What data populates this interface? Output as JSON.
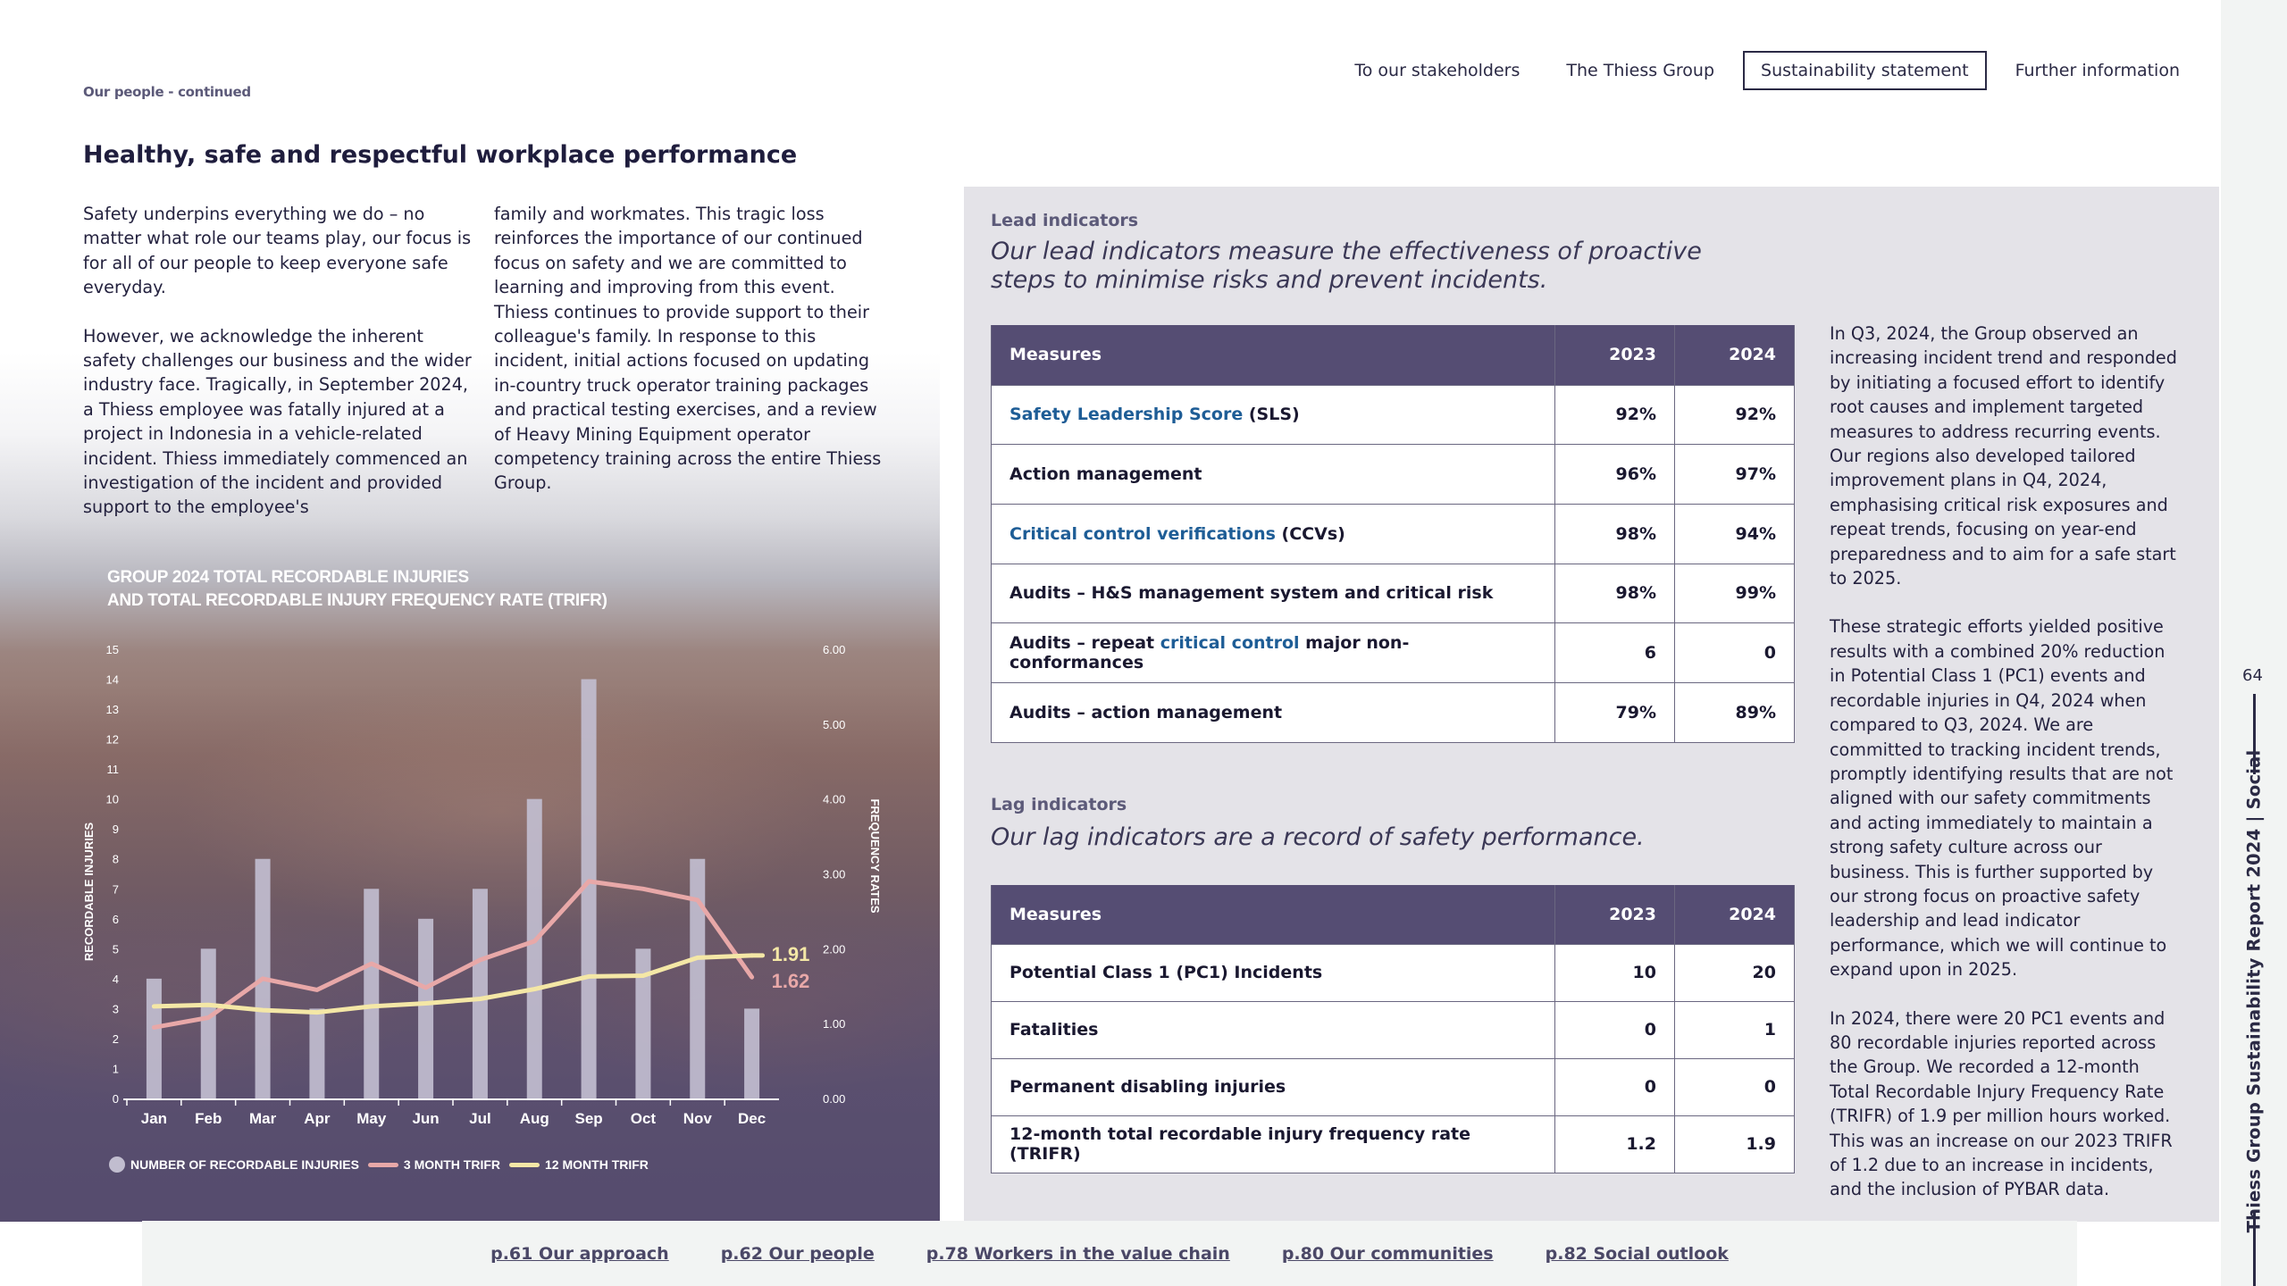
{
  "nav": {
    "items": [
      {
        "label": "To our stakeholders",
        "active": false
      },
      {
        "label": "The Thiess Group",
        "active": false
      },
      {
        "label": "Sustainability statement",
        "active": true
      },
      {
        "label": "Further information",
        "active": false
      }
    ]
  },
  "section_kicker": "Our people - continued",
  "heading": "Healthy, safe and respectful workplace performance",
  "intro": {
    "left": [
      "Safety underpins everything we do – no matter what role our teams play, our focus is for all of our people to keep everyone safe everyday.",
      "However, we acknowledge the inherent safety challenges our business and the wider industry face. Tragically, in September 2024, a Thiess employee was fatally injured at a project in Indonesia in a vehicle-related incident. Thiess immediately commenced an investigation of the incident and provided support to the employee's"
    ],
    "right": [
      "family and workmates. This tragic loss reinforces the importance of our continued focus on safety and we are committed to learning and improving from this event. Thiess continues to provide support to their colleague's family. In response to this incident, initial actions focused on updating in-country truck operator training packages and practical testing exercises, and a review of Heavy Mining Equipment operator competency training across the entire Thiess Group."
    ]
  },
  "chart_data": {
    "type": "bar",
    "title": [
      "GROUP 2024 TOTAL RECORDABLE INJURIES",
      "AND TOTAL RECORDABLE INJURY FREQUENCY RATE (TRIFR)"
    ],
    "categories": [
      "Jan",
      "Feb",
      "Mar",
      "Apr",
      "May",
      "Jun",
      "Jul",
      "Aug",
      "Sep",
      "Oct",
      "Nov",
      "Dec"
    ],
    "ylabel": "RECORDABLE INJURIES",
    "y2label": "FREQUENCY RATES",
    "ylim": [
      0,
      15
    ],
    "yticks": [
      "0",
      "1",
      "2",
      "3",
      "4",
      "5",
      "6",
      "7",
      "8",
      "9",
      "10",
      "11",
      "12",
      "13",
      "14",
      "15"
    ],
    "y2lim": [
      0,
      6
    ],
    "y2ticks": [
      "0.00",
      "1.00",
      "2.00",
      "3.00",
      "4.00",
      "5.00",
      "6.00"
    ],
    "series": [
      {
        "name": "NUMBER OF RECORDABLE INJURIES",
        "kind": "bar",
        "axis": "left",
        "color": "#c1bdcf",
        "values": [
          4,
          5,
          8,
          3,
          7,
          6,
          7,
          10,
          14,
          5,
          8,
          3
        ]
      },
      {
        "name": "3 MONTH TRIFR",
        "kind": "line",
        "axis": "right",
        "color": "#e8a8a8",
        "values": [
          0.95,
          1.08,
          1.6,
          1.45,
          1.8,
          1.48,
          1.85,
          2.1,
          2.9,
          2.8,
          2.65,
          1.62
        ]
      },
      {
        "name": "12 MONTH TRIFR",
        "kind": "line",
        "axis": "right",
        "color": "#f4e7a6",
        "values": [
          1.23,
          1.25,
          1.18,
          1.15,
          1.23,
          1.27,
          1.33,
          1.46,
          1.63,
          1.64,
          1.88,
          1.91
        ]
      }
    ],
    "end_labels": [
      {
        "text": "1.91",
        "color": "#f4e7a6"
      },
      {
        "text": "1.62",
        "color": "#e8a8a8"
      }
    ],
    "legend_position": "bottom-left"
  },
  "lead": {
    "label": "Lead indicators",
    "subtitle_lines": [
      "Our lead indicators measure the effectiveness of proactive",
      "steps to minimise risks and prevent incidents."
    ],
    "headers": [
      "Measures",
      "2023",
      "2024"
    ],
    "rows": [
      {
        "segments": [
          {
            "text": "Safety Leadership Score",
            "link": true
          },
          {
            "text": " (SLS)",
            "link": false
          }
        ],
        "v2023": "92%",
        "v2024": "92%"
      },
      {
        "segments": [
          {
            "text": "Action management",
            "link": false
          }
        ],
        "v2023": "96%",
        "v2024": "97%"
      },
      {
        "segments": [
          {
            "text": "Critical control verifications",
            "link": true
          },
          {
            "text": " (CCVs)",
            "link": false
          }
        ],
        "v2023": "98%",
        "v2024": "94%"
      },
      {
        "segments": [
          {
            "text": "Audits – H&S management system and critical risk",
            "link": false
          }
        ],
        "v2023": "98%",
        "v2024": "99%"
      },
      {
        "segments": [
          {
            "text": "Audits – repeat ",
            "link": false
          },
          {
            "text": "critical control",
            "link": true
          },
          {
            "text": " major non-conformances",
            "link": false
          }
        ],
        "v2023": "6",
        "v2024": "0"
      },
      {
        "segments": [
          {
            "text": "Audits – action management",
            "link": false
          }
        ],
        "v2023": "79%",
        "v2024": "89%"
      }
    ]
  },
  "lag": {
    "label": "Lag indicators",
    "subtitle_lines": [
      "Our lag indicators are a record of safety performance."
    ],
    "headers": [
      "Measures",
      "2023",
      "2024"
    ],
    "rows": [
      {
        "segments": [
          {
            "text": "Potential Class 1 (PC1) Incidents",
            "link": false
          }
        ],
        "v2023": "10",
        "v2024": "20"
      },
      {
        "segments": [
          {
            "text": "Fatalities",
            "link": false
          }
        ],
        "v2023": "0",
        "v2024": "1"
      },
      {
        "segments": [
          {
            "text": "Permanent disabling injuries",
            "link": false
          }
        ],
        "v2023": "0",
        "v2024": "0"
      },
      {
        "segments": [
          {
            "text": "12-month total recordable injury frequency rate (TRIFR)",
            "link": false
          }
        ],
        "v2023": "1.2",
        "v2024": "1.9"
      }
    ]
  },
  "side_paragraphs": [
    "In Q3, 2024, the Group observed an increasing incident trend and responded by initiating a focused effort to identify root causes and implement targeted measures to address recurring events. Our regions also developed tailored improvement plans in Q4, 2024, emphasising critical risk exposures and repeat trends, focusing on year-end preparedness and to aim for a safe start to 2025.",
    "These strategic efforts yielded positive results with a combined 20% reduction in Potential Class 1 (PC1) events and recordable injuries in Q4, 2024 when compared to Q3, 2024. We are committed to tracking incident trends, promptly identifying results that are not aligned with our safety commitments and acting immediately to maintain a strong safety culture across our business. This is further supported by our strong focus on proactive safety leadership and lead indicator performance, which we will continue to expand upon in 2025.",
    "In 2024, there were 20 PC1 events and 80 recordable injuries reported across the Group. We recorded a 12-month Total Recordable Injury Frequency Rate (TRIFR) of 1.9 per million hours worked. This was an increase on our 2023 TRIFR of 1.2 due to an increase in incidents, and the inclusion of PYBAR data."
  ],
  "footer_links": [
    "p.61 Our approach",
    "p.62 Our people",
    "p.78 Workers in the value chain",
    "p.80 Our communities",
    "p.82 Social outlook"
  ],
  "page_number": "64",
  "side_title": "Thiess Group Sustainability Report 2024  |  Social"
}
